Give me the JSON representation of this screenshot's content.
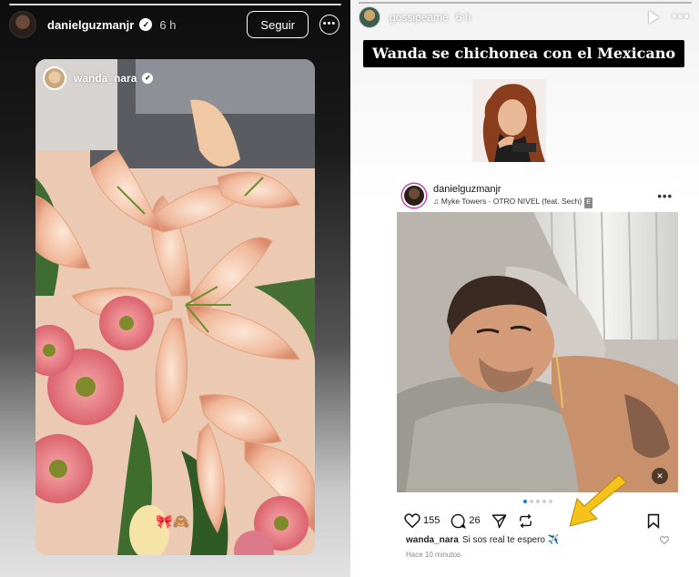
{
  "left_story": {
    "username": "danielguzmanjr",
    "time": "6 h",
    "follow_label": "Seguir",
    "more_label": "•••",
    "reshared_post": {
      "username": "wanda_nara",
      "stickers": "🎀🙈"
    }
  },
  "right_story": {
    "username": "gossipeame",
    "time": "6 h",
    "more_label": "•••",
    "headline": "Wanda se chichonea con el Mexicano",
    "post": {
      "username": "danielguzmanjr",
      "song": "Myke Towers · OTRO NIVEL (feat. Sech)",
      "explicit_label": "E",
      "more_label": "•••",
      "likes": "155",
      "comments": "26",
      "caption_user": "wanda_nara",
      "caption_text": "Si sos real te espero ✈️",
      "time_ago": "Hace 10 minutos",
      "carousel_total": 5,
      "carousel_active": 1
    }
  },
  "colors": {
    "arrow": "#f5c21b",
    "story_ring": "#c33fa5",
    "carousel_active": "#1a73e8"
  }
}
